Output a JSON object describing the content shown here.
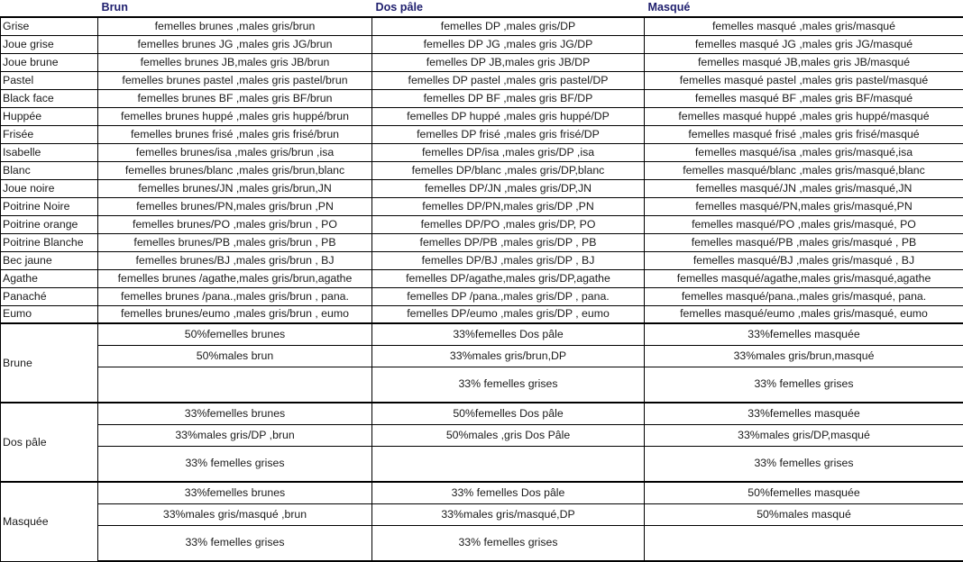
{
  "table": {
    "corner_label": "",
    "columns": [
      {
        "key": "brun",
        "label": "Brun"
      },
      {
        "key": "dp",
        "label": "Dos pâle"
      },
      {
        "key": "masq",
        "label": "Masqué"
      }
    ],
    "row_label_color": "#cc22bb",
    "header_color": "#1f1f6e",
    "rows": [
      {
        "label": "Grise",
        "cells": [
          "femelles brunes ,males gris/brun",
          "femelles DP ,males gris/DP",
          "femelles masqué ,males gris/masqué"
        ]
      },
      {
        "label": "Joue grise",
        "cells": [
          "femelles brunes JG ,males gris JG/brun",
          "femelles DP JG ,males gris JG/DP",
          "femelles masqué JG ,males gris JG/masqué"
        ]
      },
      {
        "label": "Joue brune",
        "cells": [
          "femelles brunes JB,males gris JB/brun",
          "femelles DP JB,males gris JB/DP",
          "femelles masqué JB,males gris JB/masqué"
        ]
      },
      {
        "label": "Pastel",
        "cells": [
          "femelles brunes pastel ,males gris pastel/brun",
          "femelles DP pastel ,males gris pastel/DP",
          "femelles masqué pastel ,males gris pastel/masqué"
        ]
      },
      {
        "label": "Black face",
        "cells": [
          "femelles brunes BF ,males gris BF/brun",
          "femelles DP BF ,males gris BF/DP",
          "femelles masqué BF ,males gris BF/masqué"
        ]
      },
      {
        "label": "Huppée",
        "cells": [
          "femelles brunes huppé ,males gris huppé/brun",
          "femelles DP huppé ,males gris huppé/DP",
          "femelles masqué huppé ,males gris huppé/masqué"
        ]
      },
      {
        "label": "Frisée",
        "cells": [
          "femelles brunes frisé ,males gris frisé/brun",
          "femelles DP frisé ,males gris frisé/DP",
          "femelles masqué frisé ,males gris frisé/masqué"
        ]
      },
      {
        "label": "Isabelle",
        "cells": [
          "femelles brunes/isa ,males gris/brun ,isa",
          "femelles DP/isa ,males gris/DP ,isa",
          "femelles masqué/isa ,males gris/masqué,isa"
        ]
      },
      {
        "label": "Blanc",
        "cells": [
          "femelles brunes/blanc ,males gris/brun,blanc",
          "femelles DP/blanc ,males gris/DP,blanc",
          "femelles masqué/blanc ,males gris/masqué,blanc"
        ]
      },
      {
        "label": "Joue noire",
        "cells": [
          "femelles brunes/JN ,males gris/brun,JN",
          "femelles DP/JN ,males gris/DP,JN",
          "femelles masqué/JN ,males gris/masqué,JN"
        ]
      },
      {
        "label": "Poitrine Noire",
        "cells": [
          "femelles brunes/PN,males gris/brun ,PN",
          "femelles DP/PN,males gris/DP ,PN",
          "femelles masqué/PN,males gris/masqué,PN"
        ]
      },
      {
        "label": "Poitrine orange",
        "cells": [
          "femelles brunes/PO ,males gris/brun , PO",
          "femelles DP/PO ,males gris/DP, PO",
          "femelles masqué/PO ,males gris/masqué, PO"
        ]
      },
      {
        "label": "Poitrine Blanche",
        "cells": [
          "femelles brunes/PB ,males gris/brun , PB",
          "femelles DP/PB ,males gris/DP , PB",
          "femelles masqué/PB ,males gris/masqué , PB"
        ]
      },
      {
        "label": "Bec jaune",
        "cells": [
          "femelles brunes/BJ ,males gris/brun , BJ",
          "femelles DP/BJ ,males gris/DP , BJ",
          "femelles masqué/BJ ,males gris/masqué , BJ"
        ]
      },
      {
        "label": "Agathe",
        "cells": [
          "femelles brunes /agathe,males gris/brun,agathe",
          "femelles DP/agathe,males gris/DP,agathe",
          "femelles masqué/agathe,males gris/masqué,agathe"
        ]
      },
      {
        "label": "Panaché",
        "cells": [
          "femelles brunes /pana.,males gris/brun , pana.",
          "femelles DP /pana.,males gris/DP , pana.",
          "femelles masqué/pana.,males gris/masqué, pana."
        ]
      },
      {
        "label": "Eumo",
        "cells": [
          "femelles brunes/eumo ,males gris/brun , eumo",
          "femelles DP/eumo ,males gris/DP , eumo",
          "femelles masqué/eumo ,males gris/masqué, eumo"
        ]
      }
    ],
    "summary_groups": [
      {
        "label": "Brune",
        "rows": [
          {
            "cells": [
              "50%femelles brunes",
              "33%femelles Dos pâle",
              "33%femelles masquée"
            ]
          },
          {
            "cells": [
              "50%males brun",
              "33%males gris/brun,DP",
              "33%males gris/brun,masqué"
            ]
          },
          {
            "cells": [
              "",
              "33% femelles grises",
              "33% femelles grises"
            ]
          }
        ]
      },
      {
        "label": "Dos pâle",
        "rows": [
          {
            "cells": [
              "33%femelles brunes",
              "50%femelles Dos pâle",
              "33%femelles masquée"
            ]
          },
          {
            "cells": [
              "33%males gris/DP ,brun",
              "50%males ,gris Dos Pâle",
              "33%males gris/DP,masqué"
            ]
          },
          {
            "cells": [
              "33% femelles grises",
              "",
              "33% femelles grises"
            ]
          }
        ]
      },
      {
        "label": "Masquée",
        "rows": [
          {
            "cells": [
              "33%femelles brunes",
              "33% femelles Dos pâle",
              "50%femelles masquée"
            ]
          },
          {
            "cells": [
              "33%males gris/masqué ,brun",
              "33%males gris/masqué,DP",
              "50%males masqué"
            ]
          },
          {
            "cells": [
              "33% femelles grises",
              "33% femelles grises",
              ""
            ]
          }
        ]
      }
    ]
  }
}
